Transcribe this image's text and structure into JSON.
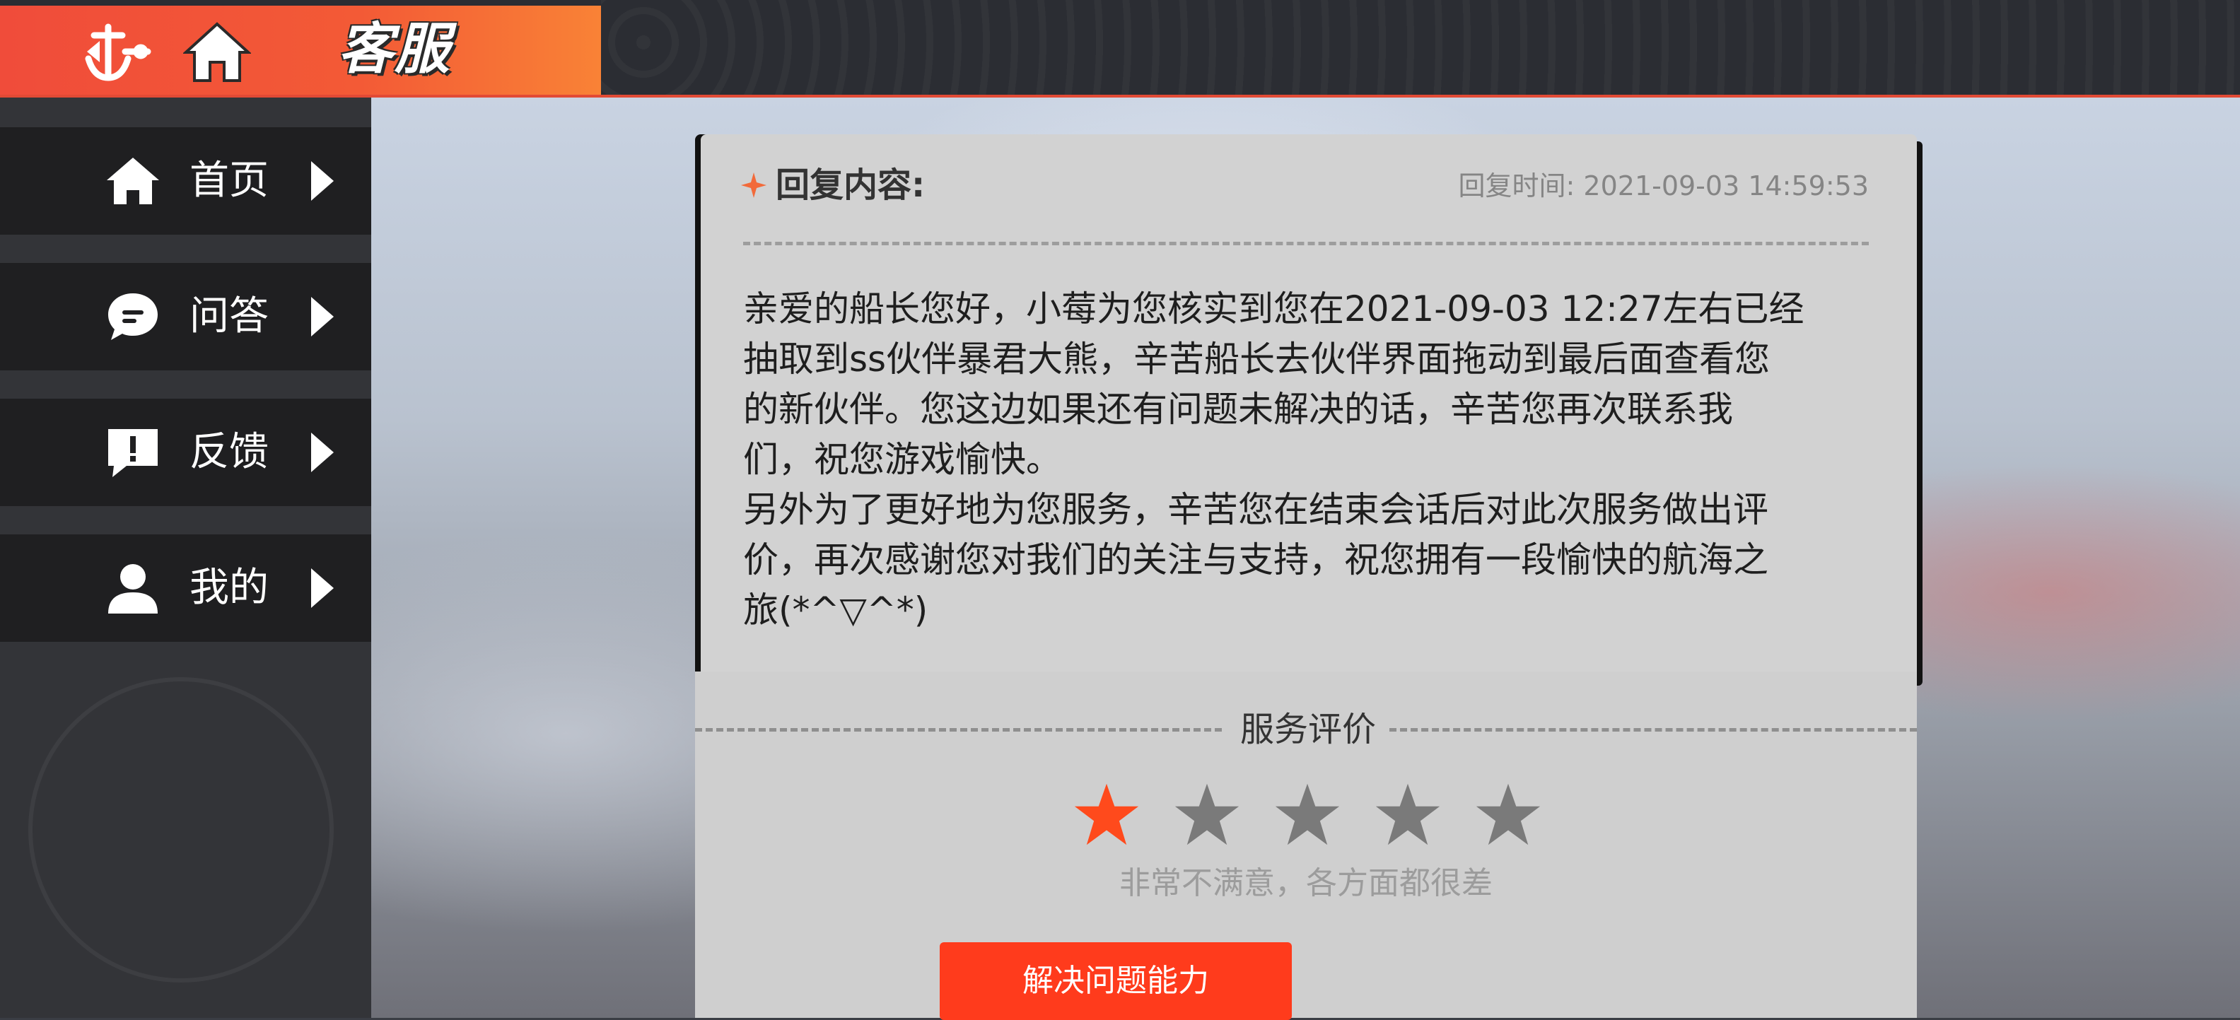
{
  "header": {
    "title": "客服",
    "back_icon": "anchor-back-icon",
    "home_icon": "home-icon"
  },
  "colors": {
    "accent": "#f04c3a",
    "button": "#ff3b1c",
    "star_active": "#ff4a1c",
    "star_inactive": "#7a7a7a"
  },
  "sidebar": {
    "items": [
      {
        "label": "首页",
        "icon": "home-icon"
      },
      {
        "label": "问答",
        "icon": "chat-bubble-icon"
      },
      {
        "label": "反馈",
        "icon": "feedback-exclamation-icon"
      },
      {
        "label": "我的",
        "icon": "user-icon"
      }
    ]
  },
  "reply": {
    "title": "回复内容:",
    "time": "回复时间: 2021-09-03 14:59:53",
    "lines": [
      "亲爱的船长您好，小莓为您核实到您在2021-09-03 12:27左右已经",
      "抽取到ss伙伴暴君大熊，辛苦船长去伙伴界面拖动到最后面查看您",
      "的新伙伴。您这边如果还有问题未解决的话，辛苦您再次联系我",
      "们，祝您游戏愉快。",
      "另外为了更好地为您服务，辛苦您在结束会话后对此次服务做出评",
      "价，再次感谢您对我们的关注与支持，祝您拥有一段愉快的航海之",
      "旅(*^▽^*)"
    ]
  },
  "evaluation": {
    "title": "服务评价",
    "rating": 1,
    "max_rating": 5,
    "rating_text": "非常不满意，各方面都很差",
    "button_label": "解决问题能力"
  }
}
